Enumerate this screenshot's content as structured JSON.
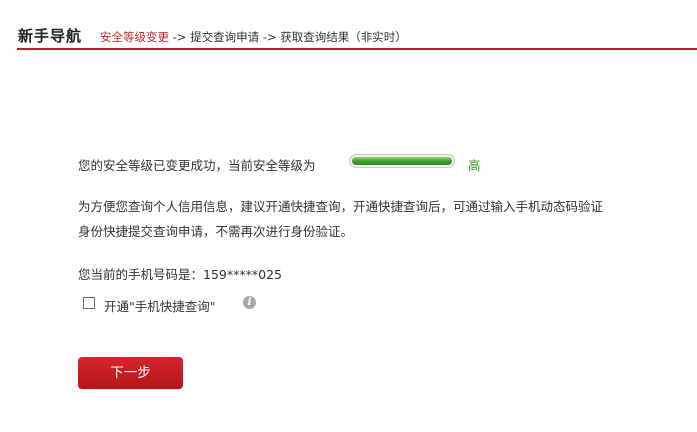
{
  "nav": {
    "title": "新手导航",
    "breadcrumb": {
      "step1": "安全等级变更",
      "sep1": " -> ",
      "step2": "提交查询申请",
      "sep2": " -> ",
      "step3": "获取查询结果（非实时）"
    }
  },
  "security": {
    "message": "您的安全等级已变更成功，当前安全等级为",
    "level_text": "高",
    "level_fraction": 1.0,
    "level_color": "#3d9b2e"
  },
  "info_paragraph": {
    "line1": "为方便您查询个人信用信息，建议开通快捷查询，开通快捷查询后，可通过输入手机动态码验证",
    "line2": "身份快捷提交查询申请，不需再次进行身份验证。"
  },
  "phone": {
    "label": "您当前的手机号码是：",
    "number": "159*****025"
  },
  "quick_query": {
    "checkbox_label": "开通\"手机快捷查询\"",
    "checked": false
  },
  "actions": {
    "next_label": "下一步"
  },
  "colors": {
    "accent": "#c0272d",
    "button": "#c8191f",
    "success": "#3a9a2a"
  }
}
